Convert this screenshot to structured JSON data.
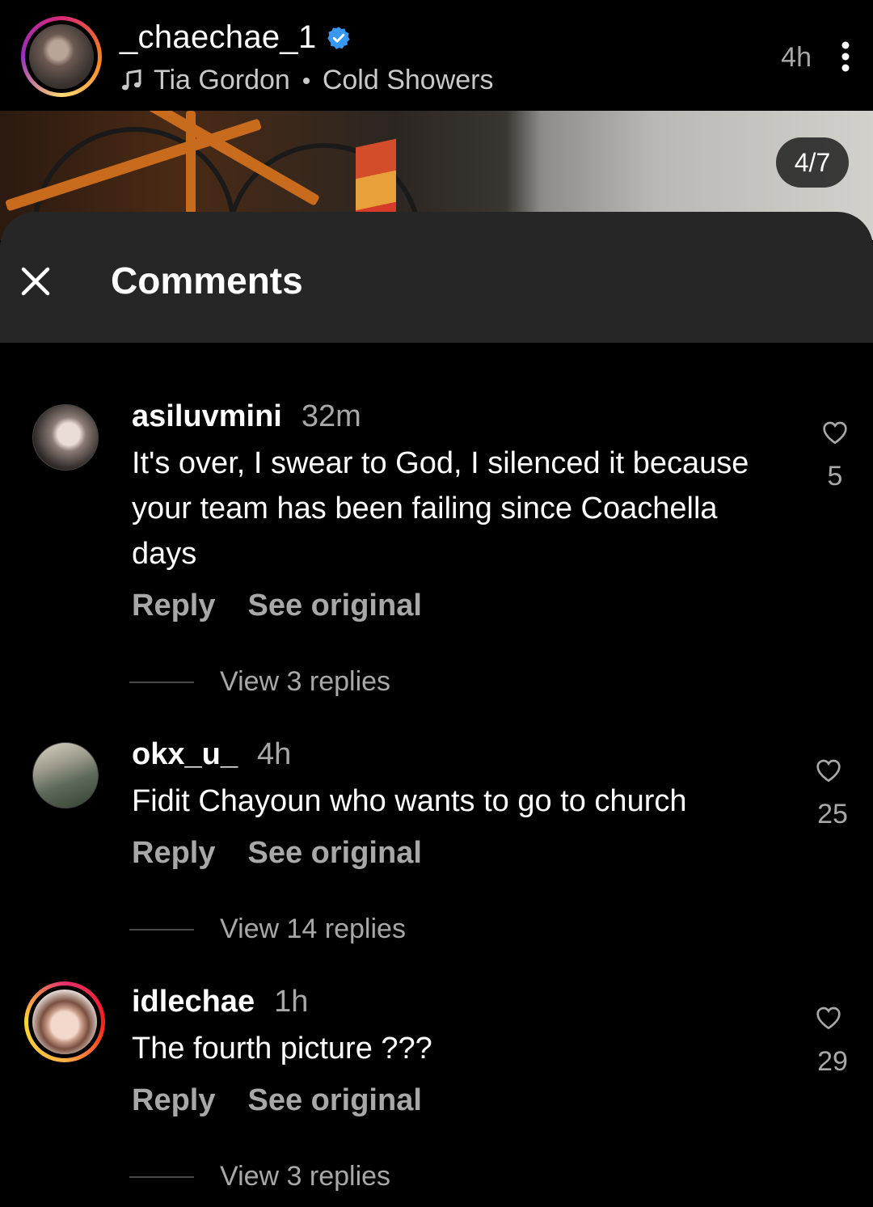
{
  "post": {
    "username": "_chaechae_1",
    "music_artist": "Tia Gordon",
    "music_track": "Cold Showers",
    "time": "4h",
    "page_indicator": "4/7"
  },
  "sheet": {
    "title": "Comments"
  },
  "comments": [
    {
      "username": "asiluvmini",
      "time": "32m",
      "text": "It's over, I swear to God, I silenced it because your team has been failing since Coachella days",
      "reply_label": "Reply",
      "see_original_label": "See original",
      "likes": "5",
      "view_replies": "View 3 replies"
    },
    {
      "username": "okx_u_",
      "time": "4h",
      "text": "Fidit Chayoun who wants to go to church",
      "reply_label": "Reply",
      "see_original_label": "See original",
      "likes": "25",
      "view_replies": "View 14 replies"
    },
    {
      "username": "idlechae",
      "time": "1h",
      "text": "The fourth picture ???",
      "reply_label": "Reply",
      "see_original_label": "See original",
      "likes": "29",
      "view_replies": "View 3 replies"
    }
  ],
  "colors": {
    "background": "#000000",
    "sheet_header": "#262626",
    "secondary_text": "#a8a8a8",
    "verified_badge": "#3897f0"
  },
  "icons": [
    "verified-badge-icon",
    "music-note-icon",
    "more-options-icon",
    "close-icon",
    "heart-icon"
  ]
}
